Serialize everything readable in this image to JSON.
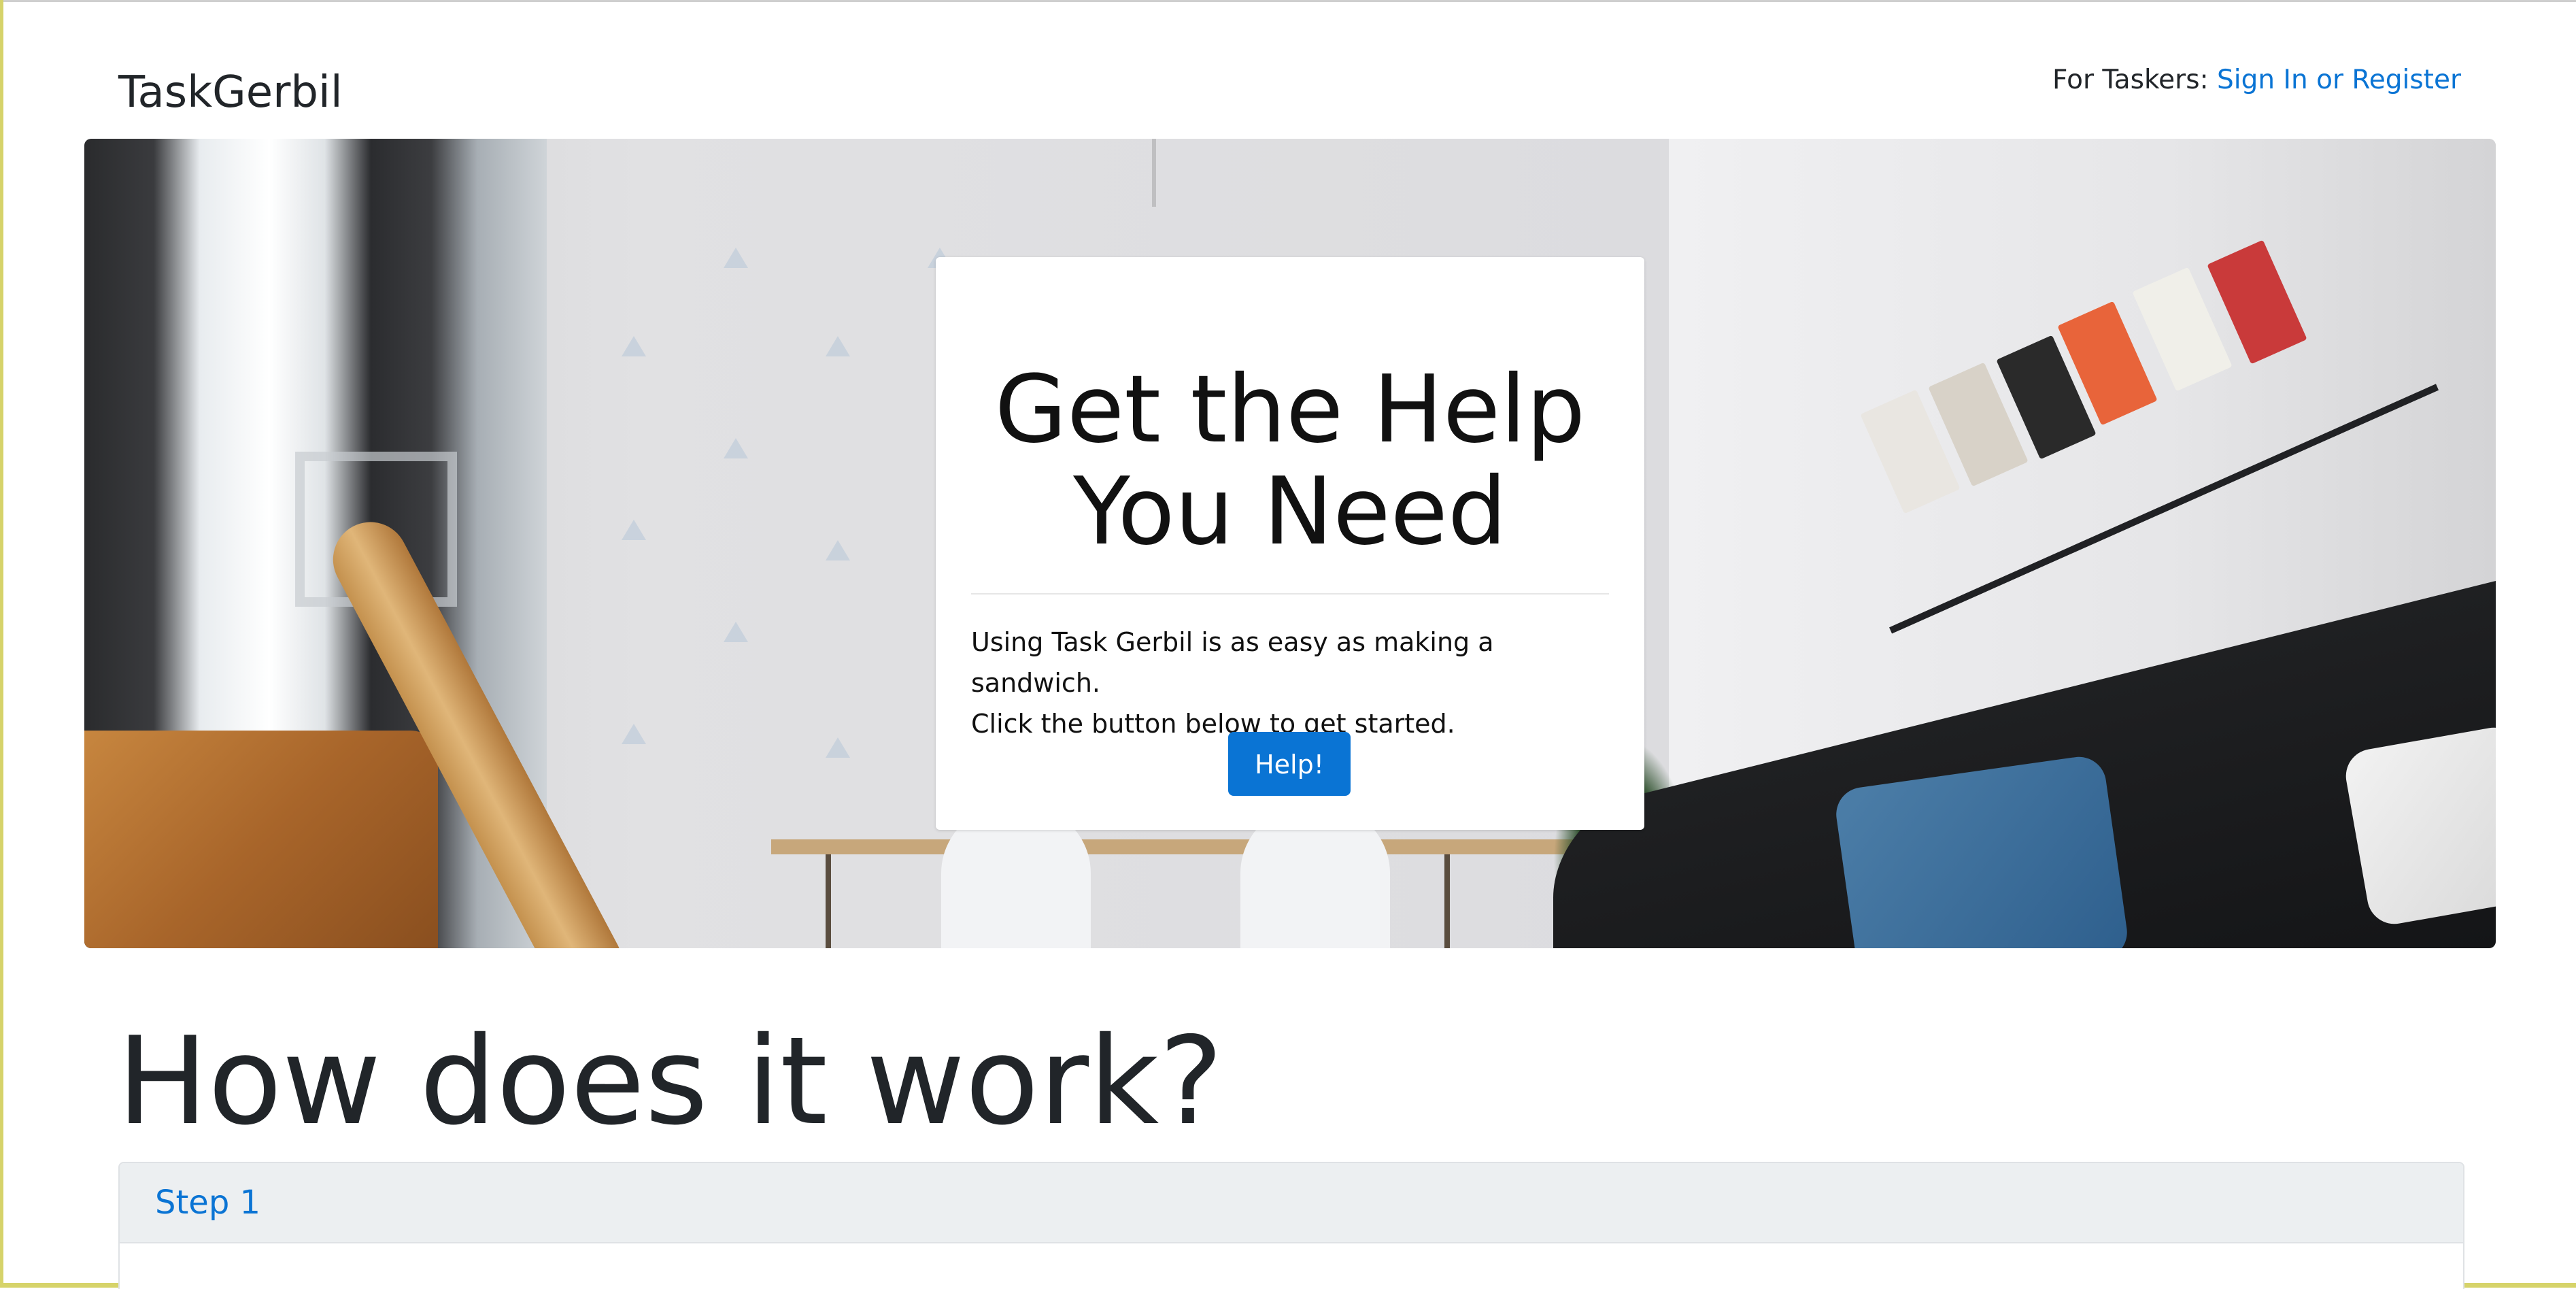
{
  "header": {
    "brand": "TaskGerbil",
    "tasker_prefix": "For Taskers: ",
    "tasker_link": "Sign In or Register"
  },
  "hero": {
    "title_line1": "Get the Help",
    "title_line2": "You Need",
    "description_line1": "Using Task Gerbil is as easy as making a sandwich.",
    "description_line2": "Click the button below to get started.",
    "button_label": "Help!"
  },
  "how_it_works": {
    "heading": "How does it work?",
    "steps": [
      {
        "label": "Step 1"
      }
    ]
  },
  "colors": {
    "accent": "#0a74d4",
    "text": "#212529",
    "step_header_bg": "#eceff1"
  }
}
